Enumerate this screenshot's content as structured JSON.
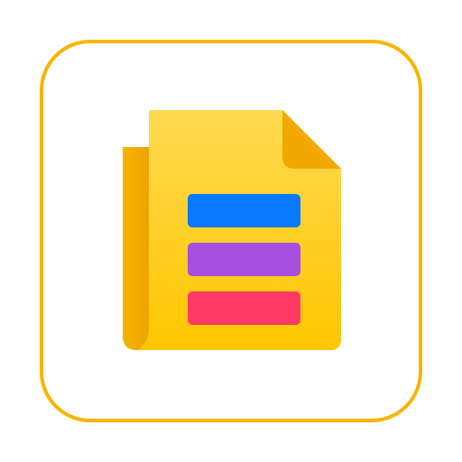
{
  "icon": {
    "name": "document-icon",
    "colors": {
      "frame_border": "#f7b500",
      "page_light": "#ffd94a",
      "page_dark": "#ffc400",
      "back_page": "#f4a900",
      "corner_fold": "#f0a800",
      "line_1": "#0a78ff",
      "line_2": "#a64fe0",
      "line_3": "#ff3a63"
    }
  }
}
